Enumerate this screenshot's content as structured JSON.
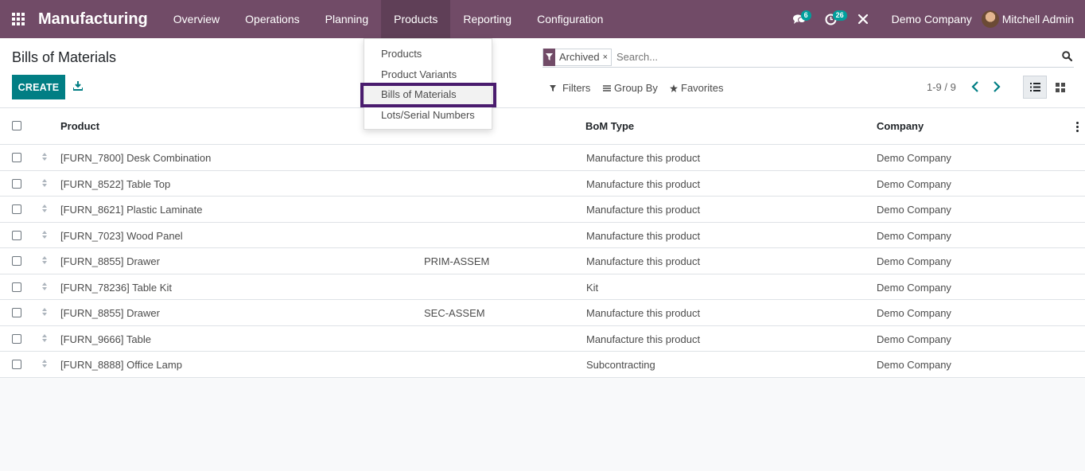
{
  "navbar": {
    "brand": "Manufacturing",
    "menu": [
      {
        "label": "Overview"
      },
      {
        "label": "Operations"
      },
      {
        "label": "Planning"
      },
      {
        "label": "Products"
      },
      {
        "label": "Reporting"
      },
      {
        "label": "Configuration"
      }
    ],
    "messages_count": "6",
    "activities_count": "26",
    "company": "Demo Company",
    "user": "Mitchell Admin",
    "colors": {
      "bar": "#714b67",
      "badge": "#00a09d"
    }
  },
  "dropdown": {
    "items": [
      {
        "label": "Products"
      },
      {
        "label": "Product Variants"
      },
      {
        "label": "Bills of Materials"
      },
      {
        "label": "Lots/Serial Numbers"
      }
    ],
    "highlighted": "Bills of Materials"
  },
  "control": {
    "title": "Bills of Materials",
    "create_label": "CREATE",
    "facet": "Archived",
    "facet_remove": "×",
    "search_placeholder": "Search...",
    "filters_label": "Filters",
    "groupby_label": "Group By",
    "favorites_label": "Favorites",
    "pager": "1-9 / 9"
  },
  "table": {
    "columns": {
      "product": "Product",
      "bom_type": "BoM Type",
      "company": "Company"
    },
    "rows": [
      {
        "product": "[FURN_7800] Desk Combination",
        "reference": "",
        "bom_type": "Manufacture this product",
        "company": "Demo Company"
      },
      {
        "product": "[FURN_8522] Table Top",
        "reference": "",
        "bom_type": "Manufacture this product",
        "company": "Demo Company"
      },
      {
        "product": "[FURN_8621] Plastic Laminate",
        "reference": "",
        "bom_type": "Manufacture this product",
        "company": "Demo Company"
      },
      {
        "product": "[FURN_7023] Wood Panel",
        "reference": "",
        "bom_type": "Manufacture this product",
        "company": "Demo Company"
      },
      {
        "product": "[FURN_8855] Drawer",
        "reference": "PRIM-ASSEM",
        "bom_type": "Manufacture this product",
        "company": "Demo Company"
      },
      {
        "product": "[FURN_78236] Table Kit",
        "reference": "",
        "bom_type": "Kit",
        "company": "Demo Company"
      },
      {
        "product": "[FURN_8855] Drawer",
        "reference": "SEC-ASSEM",
        "bom_type": "Manufacture this product",
        "company": "Demo Company"
      },
      {
        "product": "[FURN_9666] Table",
        "reference": "",
        "bom_type": "Manufacture this product",
        "company": "Demo Company"
      },
      {
        "product": "[FURN_8888] Office Lamp",
        "reference": "",
        "bom_type": "Subcontracting",
        "company": "Demo Company"
      }
    ]
  }
}
